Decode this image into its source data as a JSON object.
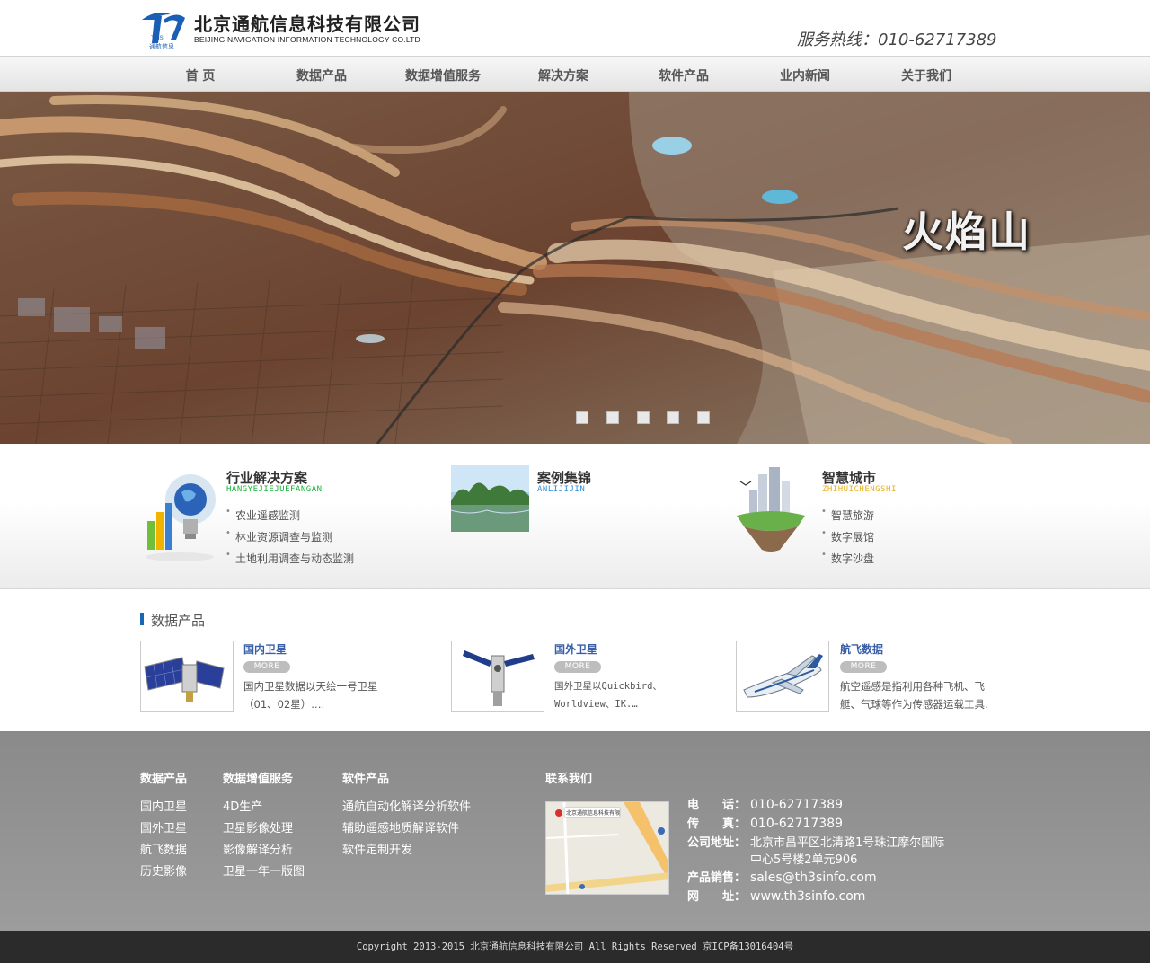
{
  "header": {
    "company_cn": "北京通航信息科技有限公司",
    "company_en": "BEIJING NAVIGATION INFORMATION TECHNOLOGY CO.LTD",
    "logo_mark_text": "THIS",
    "logo_sub": "通航信息",
    "hotline": "服务热线：010-62717389"
  },
  "nav": [
    {
      "label": "首 页"
    },
    {
      "label": "数据产品"
    },
    {
      "label": "数据增值服务"
    },
    {
      "label": "解决方案"
    },
    {
      "label": "软件产品"
    },
    {
      "label": "业内新闻"
    },
    {
      "label": "关于我们"
    }
  ],
  "banner": {
    "title": "火焰山",
    "slide_count": 5
  },
  "solutions": [
    {
      "title": "行业解决方案",
      "pinyin": "HANGYEJIEJUEFANGAN",
      "pinyin_color": "#19b33a",
      "links": [
        "农业遥感监测",
        "林业资源调查与监测",
        "土地利用调查与动态监测"
      ]
    },
    {
      "title": "案例集锦",
      "pinyin": "ANLIJIJIN",
      "pinyin_color": "#2f8fd8",
      "links": []
    },
    {
      "title": "智慧城市",
      "pinyin": "ZHIHUICHENGSHI",
      "pinyin_color": "#e8b020",
      "links": [
        "智慧旅游",
        "数字展馆",
        "数字沙盘"
      ]
    }
  ],
  "products": {
    "heading": "数据产品",
    "more_label": "MORE",
    "items": [
      {
        "name": "国内卫星",
        "desc": "国内卫星数据以天绘一号卫星（01、02星）.…"
      },
      {
        "name": "国外卫星",
        "desc": "国外卫星以Quickbird、Worldview、IK.…"
      },
      {
        "name": "航飞数据",
        "desc": "航空遥感是指利用各种飞机、飞艇、气球等作为传感器运载工具."
      }
    ]
  },
  "footer": {
    "columns": [
      {
        "heading": "数据产品",
        "links": [
          "国内卫星",
          "国外卫星",
          "航飞数据",
          "历史影像"
        ]
      },
      {
        "heading": "数据增值服务",
        "links": [
          "4D生产",
          "卫星影像处理",
          "影像解译分析",
          "卫星一年一版图"
        ]
      },
      {
        "heading": "软件产品",
        "links": [
          "通航自动化解译分析软件",
          "辅助遥感地质解译软件",
          "软件定制开发"
        ]
      }
    ],
    "contact_heading": "联系我们",
    "map_label": "北京通航信息科技有限",
    "contact": [
      {
        "label": "电　　话：",
        "value": "010-62717389"
      },
      {
        "label": "传　　真：",
        "value": "010-62717389"
      },
      {
        "label": "公司地址：",
        "value": "北京市昌平区北清路1号珠江摩尔国际"
      },
      {
        "label": "",
        "value": "中心5号楼2单元906"
      },
      {
        "label": "产品销售：",
        "value": "sales@th3sinfo.com"
      },
      {
        "label": "网　　址：",
        "value": "www.th3sinfo.com"
      }
    ],
    "copyright": "Copyright 2013-2015 北京通航信息科技有限公司 All Rights Reserved  京ICP备13016404号"
  },
  "colors": {
    "accent_blue": "#1767b3",
    "product_link": "#3a5fa8",
    "footer_bg": "#939393",
    "copyright_bg": "#2b2b2b"
  }
}
